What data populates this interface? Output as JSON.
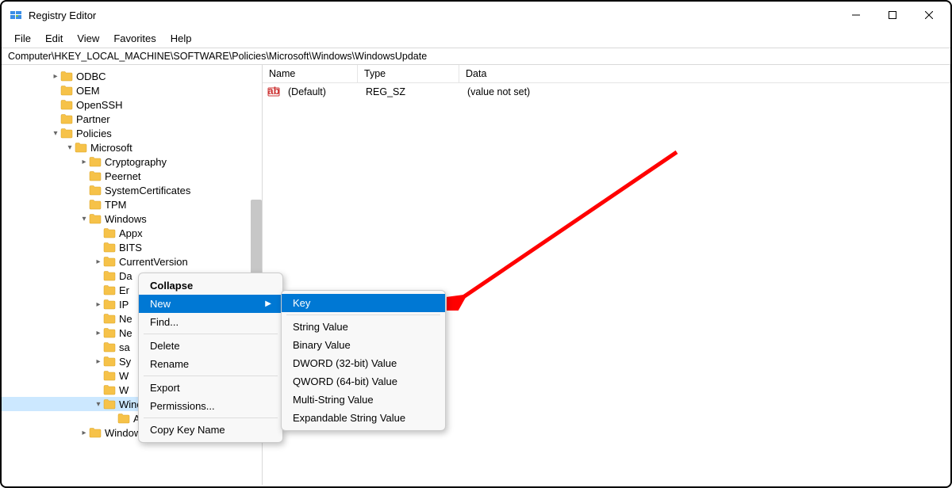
{
  "app": {
    "title": "Registry Editor"
  },
  "menubar": [
    "File",
    "Edit",
    "View",
    "Favorites",
    "Help"
  ],
  "address": "Computer\\HKEY_LOCAL_MACHINE\\SOFTWARE\\Policies\\Microsoft\\Windows\\WindowsUpdate",
  "tree": [
    {
      "indent": 3,
      "chev": ">",
      "label": "ODBC"
    },
    {
      "indent": 3,
      "chev": "",
      "label": "OEM"
    },
    {
      "indent": 3,
      "chev": "",
      "label": "OpenSSH"
    },
    {
      "indent": 3,
      "chev": "",
      "label": "Partner"
    },
    {
      "indent": 3,
      "chev": "v",
      "label": "Policies"
    },
    {
      "indent": 4,
      "chev": "v",
      "label": "Microsoft"
    },
    {
      "indent": 5,
      "chev": ">",
      "label": "Cryptography"
    },
    {
      "indent": 5,
      "chev": "",
      "label": "Peernet"
    },
    {
      "indent": 5,
      "chev": "",
      "label": "SystemCertificates"
    },
    {
      "indent": 5,
      "chev": "",
      "label": "TPM"
    },
    {
      "indent": 5,
      "chev": "v",
      "label": "Windows"
    },
    {
      "indent": 6,
      "chev": "",
      "label": "Appx"
    },
    {
      "indent": 6,
      "chev": "",
      "label": "BITS"
    },
    {
      "indent": 6,
      "chev": ">",
      "label": "CurrentVersion"
    },
    {
      "indent": 6,
      "chev": "",
      "label": "Da"
    },
    {
      "indent": 6,
      "chev": "",
      "label": "Er"
    },
    {
      "indent": 6,
      "chev": ">",
      "label": "IP"
    },
    {
      "indent": 6,
      "chev": "",
      "label": "Ne"
    },
    {
      "indent": 6,
      "chev": ">",
      "label": "Ne"
    },
    {
      "indent": 6,
      "chev": "",
      "label": "sa"
    },
    {
      "indent": 6,
      "chev": ">",
      "label": "Sy"
    },
    {
      "indent": 6,
      "chev": "",
      "label": "W"
    },
    {
      "indent": 6,
      "chev": "",
      "label": "W"
    },
    {
      "indent": 6,
      "chev": "v",
      "label": "WindowsUpdate",
      "selected": true
    },
    {
      "indent": 7,
      "chev": "",
      "label": "AU"
    },
    {
      "indent": 5,
      "chev": ">",
      "label": "Windows Defender"
    }
  ],
  "list": {
    "columns": [
      "Name",
      "Type",
      "Data"
    ],
    "rows": [
      {
        "name": "(Default)",
        "type": "REG_SZ",
        "data": "(value not set)"
      }
    ]
  },
  "context_menu": {
    "items": [
      {
        "label": "Collapse",
        "bold": true
      },
      {
        "label": "New",
        "highlight": true,
        "submenu": true
      },
      {
        "label": "Find..."
      },
      {
        "sep": true
      },
      {
        "label": "Delete"
      },
      {
        "label": "Rename"
      },
      {
        "sep": true
      },
      {
        "label": "Export"
      },
      {
        "label": "Permissions..."
      },
      {
        "sep": true
      },
      {
        "label": "Copy Key Name"
      }
    ]
  },
  "submenu": {
    "items": [
      {
        "label": "Key",
        "highlight": true
      },
      {
        "sep": true
      },
      {
        "label": "String Value"
      },
      {
        "label": "Binary Value"
      },
      {
        "label": "DWORD (32-bit) Value"
      },
      {
        "label": "QWORD (64-bit) Value"
      },
      {
        "label": "Multi-String Value"
      },
      {
        "label": "Expandable String Value"
      }
    ]
  }
}
